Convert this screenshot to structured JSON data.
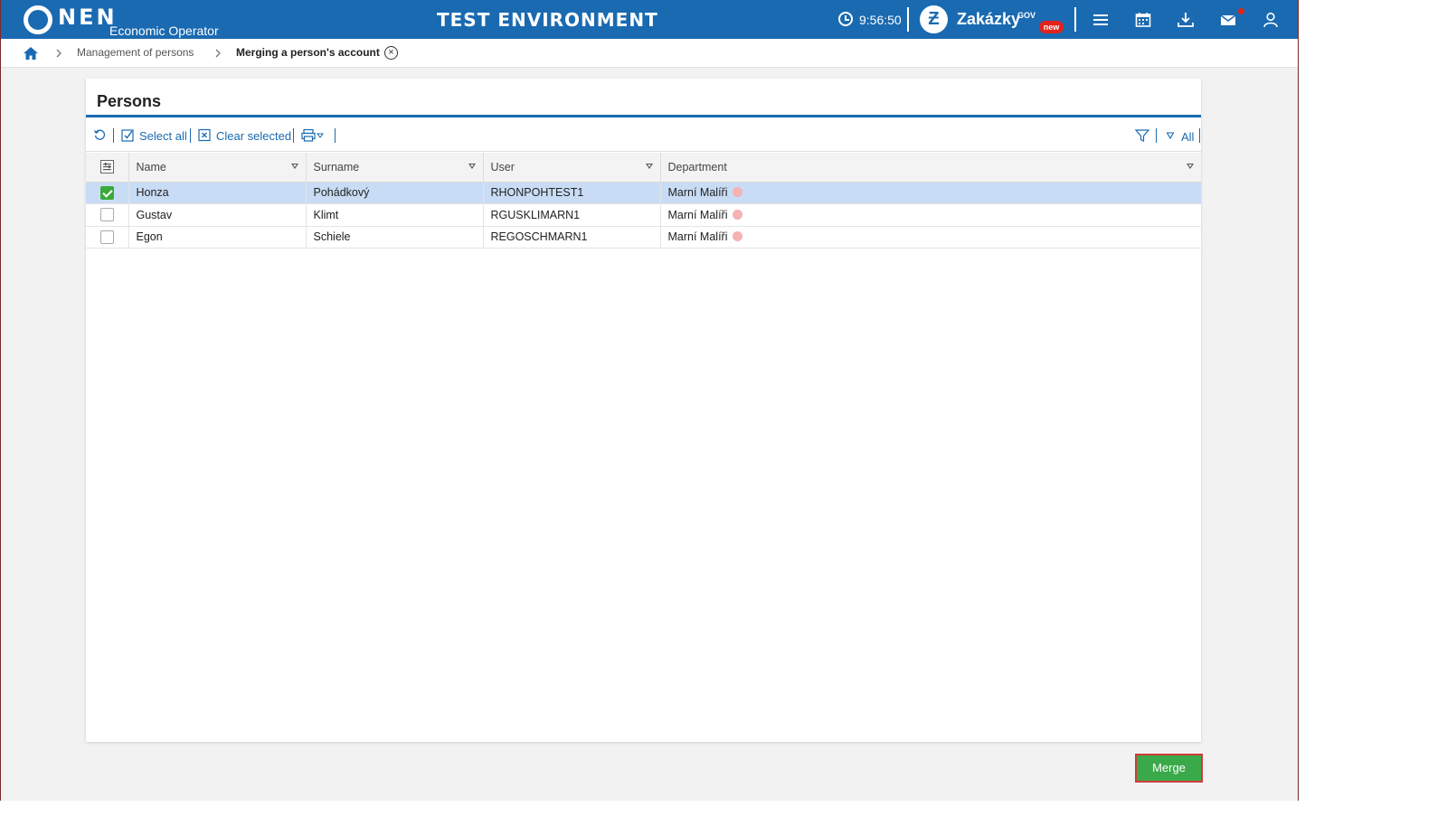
{
  "header": {
    "logo_text": "NEN",
    "logo_subtitle": "Economic Operator",
    "environment_label": "TEST ENVIRONMENT",
    "time": "9:56:50",
    "zakazky_label": "Zakázky",
    "gov_label": "GOV",
    "new_badge": "new",
    "icons": [
      "menu-icon",
      "calendar-icon",
      "download-icon",
      "mail-icon",
      "user-icon"
    ]
  },
  "breadcrumb": {
    "items": [
      "Management of persons"
    ],
    "current": "Merging a person's account"
  },
  "panel": {
    "title": "Persons",
    "toolbar": {
      "select_all": "Select all",
      "clear_selected": "Clear selected",
      "filter_all": "All"
    },
    "columns": [
      "Name",
      "Surname",
      "User",
      "Department"
    ],
    "rows": [
      {
        "name": "Honza",
        "surname": "Pohádkový",
        "user": "RHONPOHTEST1",
        "department": "Marní Malíři",
        "selected": true
      },
      {
        "name": "Gustav",
        "surname": "Klimt",
        "user": "RGUSKLIMARN1",
        "department": "Marní Malíři",
        "selected": false
      },
      {
        "name": "Egon",
        "surname": "Schiele",
        "user": "REGOSCHMARN1",
        "department": "Marní Malíři",
        "selected": false
      }
    ]
  },
  "actions": {
    "merge_label": "Merge"
  },
  "colors": {
    "primary": "#1a6ab1",
    "selected_row": "#c9dcf5",
    "checkbox_checked": "#3aa93a",
    "merge_button": "#3aa94a",
    "badge_red": "#e2231a"
  }
}
